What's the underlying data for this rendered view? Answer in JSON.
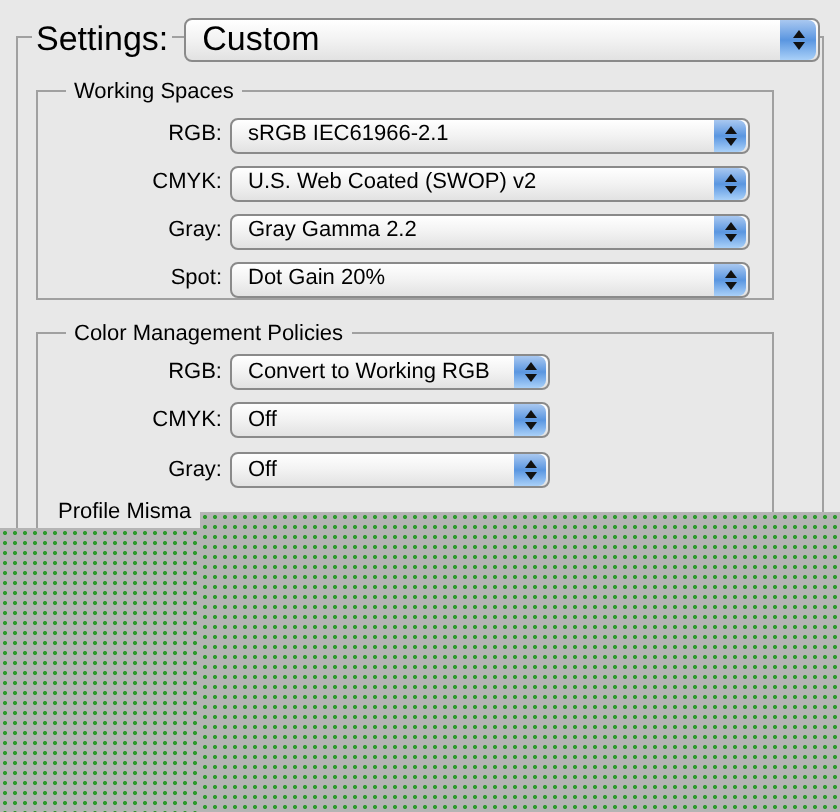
{
  "settings": {
    "label": "Settings:",
    "value": "Custom"
  },
  "working_spaces": {
    "title": "Working Spaces",
    "rows": [
      {
        "label": "RGB:",
        "value": "sRGB IEC61966-2.1"
      },
      {
        "label": "CMYK:",
        "value": "U.S. Web Coated (SWOP) v2"
      },
      {
        "label": "Gray:",
        "value": "Gray Gamma 2.2"
      },
      {
        "label": "Spot:",
        "value": "Dot Gain 20%"
      }
    ]
  },
  "policies": {
    "title": "Color Management Policies",
    "rows": [
      {
        "label": "RGB:",
        "value": "Convert to Working RGB"
      },
      {
        "label": "CMYK:",
        "value": "Off"
      },
      {
        "label": "Gray:",
        "value": "Off"
      }
    ],
    "profile_mismatches_label": "Profile Misma"
  }
}
